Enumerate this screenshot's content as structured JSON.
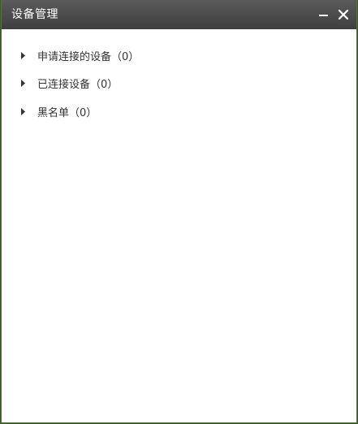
{
  "window": {
    "title": "设备管理",
    "minimize_icon": "minimize-icon",
    "close_icon": "close-icon"
  },
  "tree": {
    "items": [
      {
        "label": "申请连接的设备（0）",
        "icon": "caret-right-icon"
      },
      {
        "label": "已连接设备（0）",
        "icon": "caret-right-icon"
      },
      {
        "label": "黑名单（0）",
        "icon": "caret-right-icon"
      }
    ]
  },
  "colors": {
    "titlebar_top": "#5a5a5a",
    "titlebar_bottom": "#3f3f3f",
    "text": "#333333",
    "background": "#ffffff"
  }
}
